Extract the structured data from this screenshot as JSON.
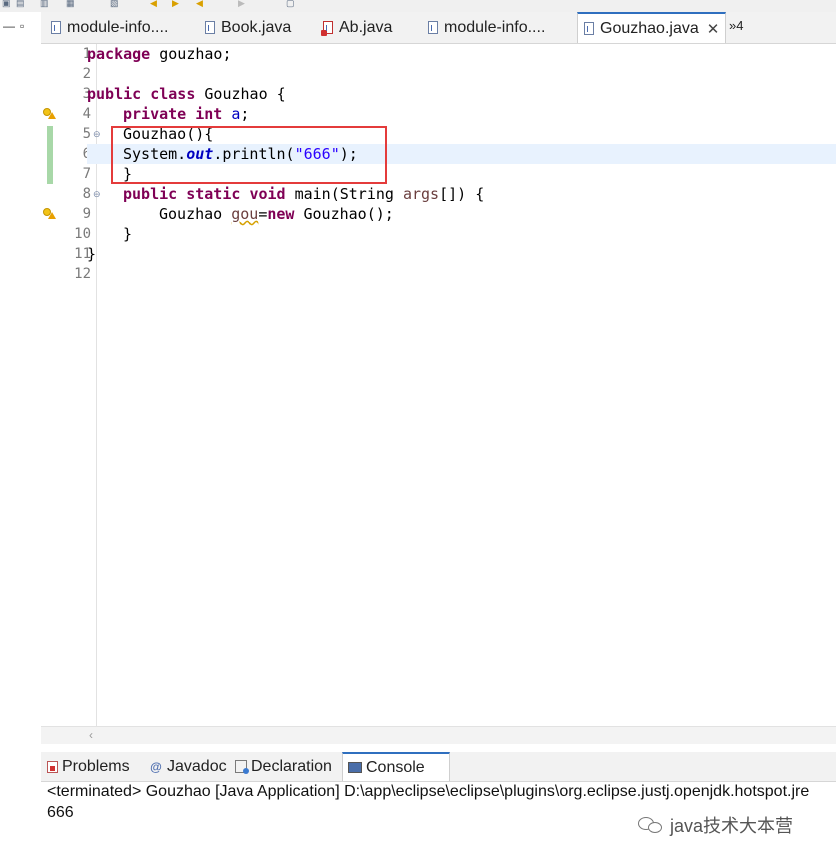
{
  "editor_tabs": [
    {
      "label": "module-info....",
      "icon": "java-file-icon"
    },
    {
      "label": "Book.java",
      "icon": "java-file-icon"
    },
    {
      "label": "Ab.java",
      "icon": "java-file-error-icon"
    },
    {
      "label": "module-info....",
      "icon": "java-file-icon"
    },
    {
      "label": "Gouzhao.java",
      "icon": "java-file-icon",
      "active": true
    }
  ],
  "tab_overflow": "»4",
  "close_glyph": "✕",
  "code": {
    "line_numbers": [
      "1",
      "2",
      "3",
      "4",
      "5",
      "6",
      "7",
      "8",
      "9",
      "10",
      "11",
      "12"
    ],
    "lines": {
      "l1": {
        "kw": "package",
        "rest": " gouzhao;"
      },
      "l3": {
        "kw1": "public",
        "kw2": "class",
        "rest": " Gouzhao {"
      },
      "l4": {
        "kw1": "private",
        "kw2": "int",
        "field": "a",
        "rest": ";"
      },
      "l5": "Gouzhao(){",
      "l6": {
        "pre": "System.",
        "static_field": "out",
        "mid": ".println(",
        "str": "\"666\"",
        "post": ");"
      },
      "l7": "}",
      "l8": {
        "kw1": "public",
        "kw2": "static",
        "kw3": "void",
        "mid": " main(String ",
        "param": "args",
        "post": "[]) {"
      },
      "l9": {
        "pre": "Gouzhao ",
        "var": "gou",
        "eq": "=",
        "kw": "new",
        "post": " Gouzhao();"
      },
      "l10": "}",
      "l11": "}"
    }
  },
  "bottom_tabs": [
    {
      "label": "Problems",
      "icon": "problems-icon"
    },
    {
      "label": "Javadoc",
      "icon": "javadoc-icon",
      "glyph": "@"
    },
    {
      "label": "Declaration",
      "icon": "declaration-icon"
    },
    {
      "label": "Console",
      "icon": "console-icon",
      "active": true
    }
  ],
  "console": {
    "status": "<terminated> Gouzhao [Java Application] D:\\app\\eclipse\\eclipse\\plugins\\org.eclipse.justj.openjdk.hotspot.jre",
    "output": "666"
  },
  "watermark": "java技术大本营",
  "colors": {
    "keyword": "#7f0055",
    "field": "#0000c0",
    "string": "#2a00ff",
    "highlight_box": "#e43b3b",
    "current_line": "#e8f2fe",
    "active_tab_accent": "#2f6fbf"
  }
}
